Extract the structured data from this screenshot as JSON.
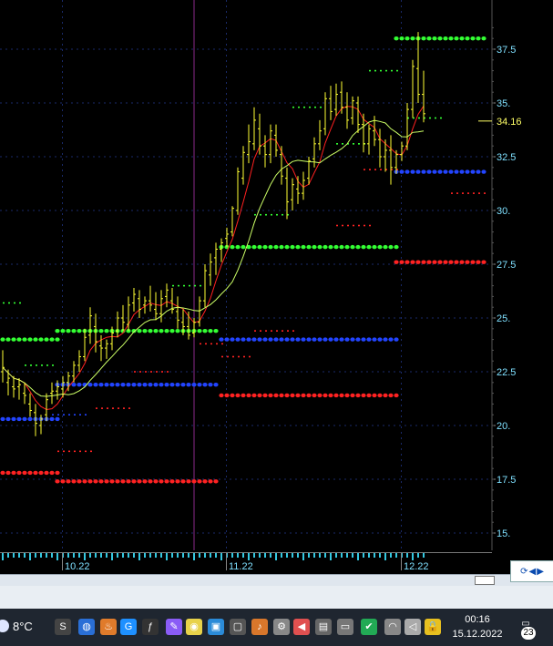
{
  "chart_data": {
    "type": "candlestick",
    "ylim": [
      14.0,
      40.0
    ],
    "y_ticks": [
      "37.5",
      "35.",
      "32.5",
      "30.",
      "27.5",
      "25.",
      "22.5",
      "20.",
      "17.5",
      "15."
    ],
    "y_tick_values": [
      37.5,
      35,
      32.5,
      30,
      27.5,
      25,
      22.5,
      20,
      17.5,
      15
    ],
    "x_labels": [
      "10.22",
      "11.22",
      "12.22"
    ],
    "last_price": "34.16",
    "last_price_value": 34.16,
    "colors": {
      "candles": "#ffff33",
      "ma_fast": "#ff2020",
      "ma_slow": "#ccff66",
      "resistance": "#33ff33",
      "support_blue": "#2244ff",
      "support_red": "#ff2222",
      "grid": "#1a2a6a",
      "axis_text": "#7fe0ff",
      "price_label": "#ffff66"
    },
    "bars": [
      [
        22.5,
        23.5,
        22.0,
        22.7
      ],
      [
        22.0,
        22.6,
        21.4,
        22.2
      ],
      [
        21.8,
        22.3,
        21.3,
        21.7
      ],
      [
        21.8,
        22.2,
        21.2,
        21.9
      ],
      [
        21.5,
        22.0,
        21.0,
        21.4
      ],
      [
        21.0,
        21.5,
        20.4,
        20.7
      ],
      [
        20.6,
        21.0,
        19.5,
        20.1
      ],
      [
        20.0,
        20.5,
        19.6,
        20.3
      ],
      [
        20.5,
        21.5,
        20.2,
        21.2
      ],
      [
        21.5,
        22.0,
        21.0,
        21.6
      ],
      [
        21.6,
        22.1,
        21.2,
        21.8
      ],
      [
        21.7,
        22.3,
        21.3,
        22.0
      ],
      [
        22.0,
        22.5,
        21.6,
        22.3
      ],
      [
        22.3,
        23.0,
        22.0,
        22.8
      ],
      [
        22.8,
        23.5,
        22.5,
        23.2
      ],
      [
        23.2,
        24.5,
        23.0,
        24.1
      ],
      [
        24.2,
        25.5,
        23.8,
        25.1
      ],
      [
        24.6,
        25.2,
        23.4,
        23.9
      ],
      [
        23.7,
        24.2,
        23.0,
        23.6
      ],
      [
        23.6,
        24.0,
        23.1,
        23.8
      ],
      [
        23.8,
        24.6,
        23.5,
        24.3
      ],
      [
        24.4,
        25.3,
        24.1,
        25.0
      ],
      [
        25.0,
        25.6,
        24.4,
        24.8
      ],
      [
        24.7,
        26.0,
        24.4,
        25.6
      ],
      [
        25.7,
        26.4,
        25.3,
        26.1
      ],
      [
        25.9,
        26.3,
        25.0,
        25.4
      ],
      [
        25.6,
        26.0,
        25.2,
        25.8
      ],
      [
        25.8,
        26.5,
        25.3,
        25.6
      ],
      [
        25.4,
        26.2,
        24.9,
        25.2
      ],
      [
        25.2,
        26.3,
        24.8,
        25.9
      ],
      [
        26.0,
        26.6,
        25.5,
        26.3
      ],
      [
        25.8,
        26.4,
        25.2,
        25.4
      ],
      [
        25.3,
        26.0,
        24.5,
        24.9
      ],
      [
        24.8,
        25.4,
        24.2,
        24.6
      ],
      [
        24.6,
        25.3,
        24.0,
        24.2
      ],
      [
        24.3,
        25.0,
        24.1,
        24.8
      ],
      [
        24.8,
        26.0,
        24.6,
        25.8
      ],
      [
        25.8,
        27.5,
        25.5,
        27.2
      ],
      [
        27.0,
        28.0,
        26.5,
        27.6
      ],
      [
        27.8,
        28.5,
        27.0,
        28.2
      ],
      [
        28.2,
        28.7,
        27.6,
        28.5
      ],
      [
        28.7,
        29.2,
        28.3,
        28.9
      ],
      [
        29.0,
        30.2,
        28.8,
        30.1
      ],
      [
        30.0,
        32.0,
        29.8,
        31.8
      ],
      [
        31.5,
        33.0,
        31.2,
        32.7
      ],
      [
        32.6,
        34.0,
        32.2,
        33.2
      ],
      [
        33.1,
        34.8,
        32.8,
        34.2
      ],
      [
        33.8,
        34.5,
        32.6,
        33.0
      ],
      [
        33.0,
        33.5,
        32.0,
        32.6
      ],
      [
        32.6,
        34.0,
        32.2,
        33.7
      ],
      [
        33.5,
        34.0,
        32.5,
        32.8
      ],
      [
        32.6,
        33.0,
        31.2,
        31.6
      ],
      [
        31.5,
        32.0,
        29.6,
        30.4
      ],
      [
        30.5,
        31.5,
        30.0,
        31.2
      ],
      [
        31.0,
        31.6,
        30.3,
        30.8
      ],
      [
        30.8,
        31.8,
        30.5,
        31.4
      ],
      [
        31.5,
        32.5,
        31.2,
        32.3
      ],
      [
        32.4,
        33.4,
        32.0,
        33.1
      ],
      [
        33.1,
        34.2,
        32.8,
        33.7
      ],
      [
        33.8,
        35.5,
        33.5,
        35.2
      ],
      [
        35.2,
        35.8,
        34.2,
        34.6
      ],
      [
        34.7,
        35.9,
        34.4,
        35.4
      ],
      [
        35.5,
        36.0,
        34.5,
        34.8
      ],
      [
        34.8,
        35.5,
        33.8,
        34.2
      ],
      [
        34.3,
        35.3,
        34.0,
        35.1
      ],
      [
        35.0,
        35.3,
        33.6,
        34.0
      ],
      [
        34.0,
        34.5,
        32.7,
        33.1
      ],
      [
        33.1,
        34.0,
        32.6,
        33.8
      ],
      [
        33.7,
        34.4,
        33.0,
        33.3
      ],
      [
        33.3,
        33.8,
        32.0,
        32.5
      ],
      [
        32.5,
        33.3,
        31.8,
        32.8
      ],
      [
        32.8,
        33.5,
        31.2,
        32.0
      ],
      [
        32.0,
        32.8,
        31.7,
        32.6
      ],
      [
        32.6,
        33.2,
        32.3,
        33.0
      ],
      [
        33.0,
        35.0,
        32.8,
        34.7
      ],
      [
        34.7,
        37.0,
        34.3,
        36.7
      ],
      [
        36.6,
        38.3,
        35.0,
        35.4
      ],
      [
        35.4,
        36.5,
        34.1,
        34.5
      ]
    ],
    "levels": [
      {
        "kind": "resistance",
        "color": "green",
        "style": "dots",
        "y": 24.0,
        "from": 0,
        "to": 10
      },
      {
        "kind": "resistance",
        "color": "green",
        "style": "dashes",
        "y": 25.7,
        "from": 0,
        "to": 3
      },
      {
        "kind": "resistance",
        "color": "green",
        "style": "dots",
        "y": 24.4,
        "from": 10,
        "to": 39
      },
      {
        "kind": "resistance",
        "color": "green",
        "style": "dashes",
        "y": 22.8,
        "from": 4,
        "to": 9
      },
      {
        "kind": "resistance",
        "color": "green",
        "style": "dashes",
        "y": 26.5,
        "from": 31,
        "to": 36
      },
      {
        "kind": "resistance",
        "color": "green",
        "style": "dots",
        "y": 28.3,
        "from": 40,
        "to": 72
      },
      {
        "kind": "resistance",
        "color": "green",
        "style": "dashes",
        "y": 29.8,
        "from": 46,
        "to": 52
      },
      {
        "kind": "resistance",
        "color": "green",
        "style": "dashes",
        "y": 34.8,
        "from": 53,
        "to": 58
      },
      {
        "kind": "resistance",
        "color": "green",
        "style": "dashes",
        "y": 33.1,
        "from": 61,
        "to": 66
      },
      {
        "kind": "resistance",
        "color": "green",
        "style": "dashes",
        "y": 36.5,
        "from": 67,
        "to": 72
      },
      {
        "kind": "resistance",
        "color": "green",
        "style": "dashes",
        "y": 34.3,
        "from": 74,
        "to": 80
      },
      {
        "kind": "resistance",
        "color": "green",
        "style": "dots",
        "y": 38.0,
        "from": 72,
        "to": 88
      },
      {
        "kind": "support",
        "color": "blue",
        "style": "dots",
        "y": 20.3,
        "from": 0,
        "to": 10
      },
      {
        "kind": "support",
        "color": "blue",
        "style": "dots",
        "y": 21.9,
        "from": 10,
        "to": 39
      },
      {
        "kind": "support",
        "color": "blue",
        "style": "dashes",
        "y": 20.5,
        "from": 9,
        "to": 15
      },
      {
        "kind": "support",
        "color": "blue",
        "style": "dots",
        "y": 24.0,
        "from": 40,
        "to": 72
      },
      {
        "kind": "support",
        "color": "blue",
        "style": "dots",
        "y": 31.8,
        "from": 72,
        "to": 88
      },
      {
        "kind": "support",
        "color": "red",
        "style": "dots",
        "y": 17.8,
        "from": 0,
        "to": 10
      },
      {
        "kind": "support",
        "color": "red",
        "style": "dots",
        "y": 17.4,
        "from": 10,
        "to": 39
      },
      {
        "kind": "support",
        "color": "red",
        "style": "dashes",
        "y": 18.8,
        "from": 10,
        "to": 16
      },
      {
        "kind": "support",
        "color": "red",
        "style": "dashes",
        "y": 20.8,
        "from": 17,
        "to": 23
      },
      {
        "kind": "support",
        "color": "red",
        "style": "dashes",
        "y": 22.5,
        "from": 24,
        "to": 30
      },
      {
        "kind": "support",
        "color": "red",
        "style": "dashes",
        "y": 23.8,
        "from": 36,
        "to": 40
      },
      {
        "kind": "support",
        "color": "red",
        "style": "dashes",
        "y": 23.2,
        "from": 40,
        "to": 45
      },
      {
        "kind": "support",
        "color": "red",
        "style": "dots",
        "y": 21.4,
        "from": 40,
        "to": 72
      },
      {
        "kind": "support",
        "color": "red",
        "style": "dashes",
        "y": 24.4,
        "from": 46,
        "to": 53
      },
      {
        "kind": "support",
        "color": "red",
        "style": "dashes",
        "y": 29.3,
        "from": 61,
        "to": 67
      },
      {
        "kind": "support",
        "color": "red",
        "style": "dashes",
        "y": 31.9,
        "from": 66,
        "to": 72
      },
      {
        "kind": "support",
        "color": "red",
        "style": "dots",
        "y": 27.6,
        "from": 72,
        "to": 88
      },
      {
        "kind": "support",
        "color": "red",
        "style": "dashes",
        "y": 30.8,
        "from": 82,
        "to": 88
      }
    ],
    "vertical_marker_bar": 35,
    "x_label_bars": [
      11,
      41,
      73
    ]
  },
  "taskbar": {
    "temperature": "8°C",
    "time": "00:16",
    "date": "15.12.2022",
    "notifications": "23",
    "icons": [
      "skype-icon",
      "globe-icon",
      "fire-icon",
      "g-icon",
      "italic-f-icon",
      "pen-icon",
      "pill-icon",
      "camera-icon",
      "phone-icon",
      "sound-icon",
      "car-icon",
      "speaker-icon",
      "monitor-icon",
      "battery-icon",
      "shield-icon",
      "wifi-icon",
      "volume-icon",
      "lock-icon"
    ]
  }
}
